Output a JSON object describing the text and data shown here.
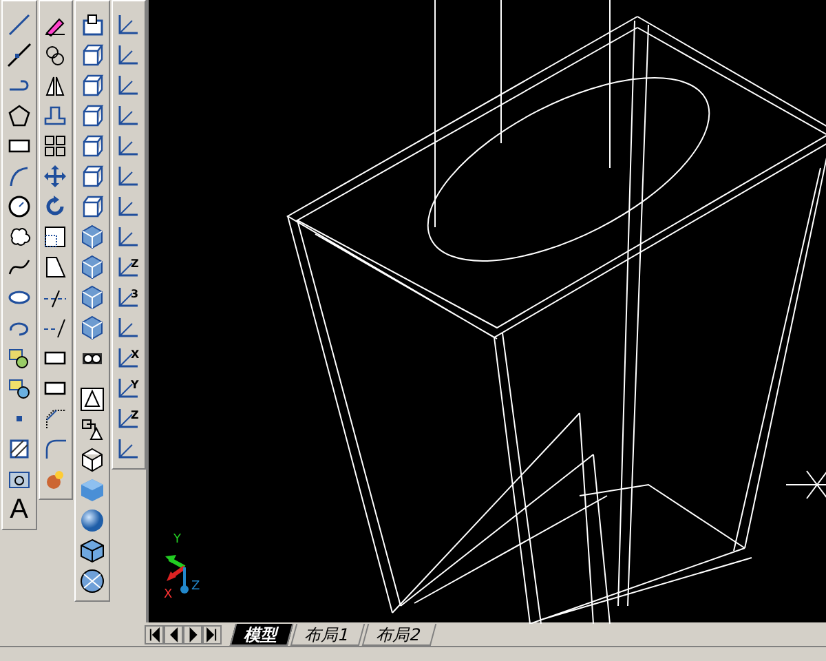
{
  "toolbars": [
    {
      "items": [
        {
          "kind": "line"
        },
        {
          "kind": "xline"
        },
        {
          "kind": "pline"
        },
        {
          "kind": "polygon"
        },
        {
          "kind": "rect"
        },
        {
          "kind": "arc"
        },
        {
          "kind": "circle"
        },
        {
          "kind": "cloud"
        },
        {
          "kind": "spline"
        },
        {
          "kind": "ellipse"
        },
        {
          "kind": "earc"
        },
        {
          "kind": "block"
        },
        {
          "kind": "insert"
        },
        {
          "kind": "point"
        },
        {
          "kind": "hatch"
        },
        {
          "kind": "region"
        },
        {
          "kind": "text",
          "label": "A"
        }
      ]
    },
    {
      "items": [
        {
          "kind": "erase"
        },
        {
          "kind": "copy"
        },
        {
          "kind": "mirror"
        },
        {
          "kind": "offset"
        },
        {
          "kind": "array"
        },
        {
          "kind": "move"
        },
        {
          "kind": "rotate"
        },
        {
          "kind": "scale"
        },
        {
          "kind": "stretch"
        },
        {
          "kind": "trim"
        },
        {
          "kind": "extend"
        },
        {
          "kind": "rect"
        },
        {
          "kind": "rect"
        },
        {
          "kind": "chamfer"
        },
        {
          "kind": "fillet"
        },
        {
          "kind": "explode"
        }
      ]
    },
    {
      "items": [
        {
          "kind": "views"
        },
        {
          "kind": "cube"
        },
        {
          "kind": "cube"
        },
        {
          "kind": "cube"
        },
        {
          "kind": "cube"
        },
        {
          "kind": "cube"
        },
        {
          "kind": "cube"
        },
        {
          "kind": "iso"
        },
        {
          "kind": "iso"
        },
        {
          "kind": "iso"
        },
        {
          "kind": "iso"
        },
        {
          "kind": "camera"
        },
        {
          "kind": "gap"
        },
        {
          "kind": "wire2d"
        },
        {
          "kind": "wire3d"
        },
        {
          "kind": "hidden"
        },
        {
          "kind": "flat"
        },
        {
          "kind": "sphere"
        },
        {
          "kind": "gouraud"
        },
        {
          "kind": "globe"
        }
      ]
    },
    {
      "items": [
        {
          "kind": "ucs"
        },
        {
          "kind": "ucs"
        },
        {
          "kind": "ucs"
        },
        {
          "kind": "ucs"
        },
        {
          "kind": "ucs"
        },
        {
          "kind": "ucs"
        },
        {
          "kind": "ucs"
        },
        {
          "kind": "ucs"
        },
        {
          "kind": "ucs",
          "label": "Z"
        },
        {
          "kind": "ucs",
          "label": "3"
        },
        {
          "kind": "ucs"
        },
        {
          "kind": "ucs",
          "label": "X"
        },
        {
          "kind": "ucs",
          "label": "Y"
        },
        {
          "kind": "ucs",
          "label": "Z"
        },
        {
          "kind": "ucs"
        }
      ]
    }
  ],
  "ucs_icon": {
    "x": "X",
    "y": "Y",
    "z": "Z"
  },
  "tabs": [
    {
      "label": "模型",
      "selected": true
    },
    {
      "label": "布局1",
      "selected": false
    },
    {
      "label": "布局2",
      "selected": false
    }
  ]
}
